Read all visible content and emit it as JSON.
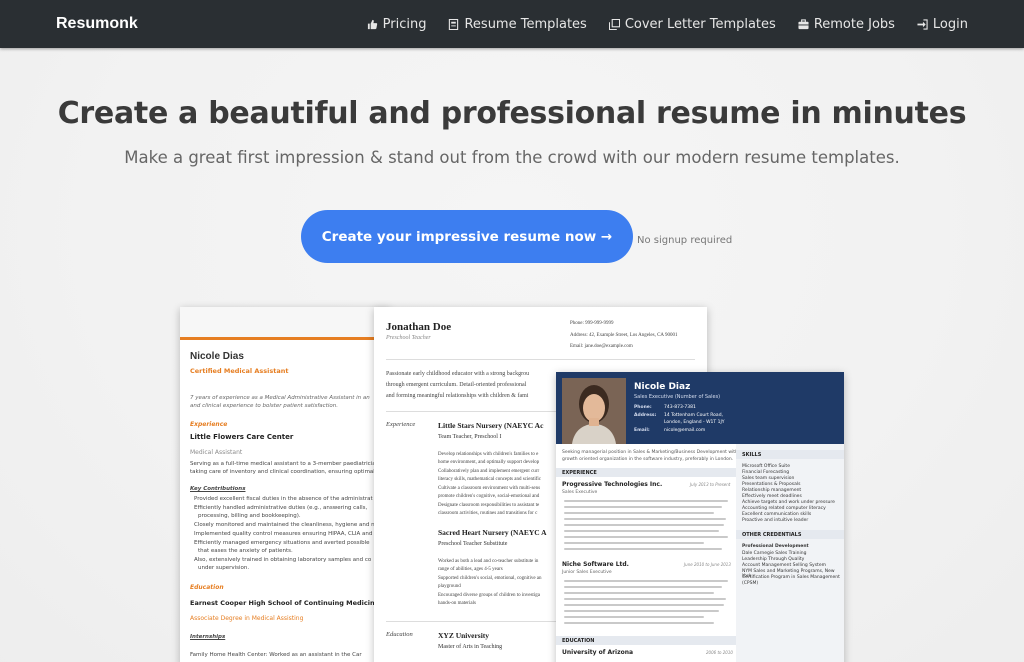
{
  "brand": "Resumonk",
  "nav": {
    "pricing": "Pricing",
    "resume_templates": "Resume Templates",
    "cover_letter_templates": "Cover Letter Templates",
    "remote_jobs": "Remote Jobs",
    "login": "Login"
  },
  "hero": {
    "title": "Create a beautiful and professional resume in minutes",
    "subtitle": "Make a great first impression & stand out from the crowd with our modern resume templates.",
    "cta": "Create your impressive resume now →",
    "cta_note": "No signup required"
  },
  "resume1": {
    "name": "Nicole Dias",
    "role": "Certified Medical Assistant",
    "summary1": "7 years of experience as a Medical Administrative Assistant in an",
    "summary2": "and clinical experience to bolster patient satisfaction.",
    "section_experience": "Experience",
    "company": "Little Flowers Care Center",
    "job_title": "Medical Assistant",
    "desc1": "Serving as a full-time medical assistant to a 3-member paediatrician",
    "desc2": "taking care of inventory and clinical coordination, ensuring optimal",
    "key_contributions": "Key Contributions",
    "b1": "Provided excellent fiscal duties in the absence of the administrat",
    "b2": "Efficiently handled administrative duties (e.g., answering calls,",
    "b2b": "processing, billing and bookkeeping).",
    "b3": "Closely monitored and maintained the cleanliness, hygiene and n",
    "b4": "Implemented quality control measures ensuring HIPAA, CLIA and",
    "b5": "Efficiently managed emergency situations and averted possible",
    "b5b": "that eases the anxiety of patients.",
    "b6": "Also, extensively trained in obtaining laboratory samples and co",
    "b6b": "under supervision.",
    "section_education": "Education",
    "school": "Earnest Cooper High School of Continuing Medicine",
    "degree": "Associate Degree in Medical Assisting",
    "internships": "Internships",
    "intern1": "Family Home Health Center: Worked as an assistant in the Car"
  },
  "resume2": {
    "name": "Jonathan Doe",
    "role": "Preschool Teacher",
    "phone": "Phone: 999-999-9999",
    "address": "Address: 42, Example Street, Los Angeles, CA 90001",
    "email": "Email: jane.doe@example.com",
    "summary1": "Passionate early childhood educator with a strong backgrou",
    "summary2": "through emergent curriculum. Detail-oriented professional",
    "summary3": "and forming meaningful relationships with children & fami",
    "section_experience": "Experience",
    "job1": "Little Stars Nursery (NAEYC Ac",
    "job1_title": "Team Teacher, Preschool I",
    "job1_b1": "Develop relationships with children's families to e",
    "job1_b1b": "home environment, and optimally support develop",
    "job1_b2": "Collaboratively plan and implement emergent curr",
    "job1_b2b": "literacy skills, mathematical concepts and scientific",
    "job1_b3": "Cultivate a classroom environment with multi-sens",
    "job1_b3b": "promote children's cognitive, social-emotional and",
    "job1_b4": "Designate classroom responsibilities to assistant te",
    "job1_b4b": "classroom activities, routines and transitions for c",
    "job2": "Sacred Heart Nursery (NAEYC A",
    "job2_title": "Preschool Teacher Substitute",
    "job2_b1": "Worked as both a lead and co-teacher substitute in",
    "job2_b1b": "range of abilities, ages 4-5 years",
    "job2_b2": "Supported children's social, emotional, cognitive an",
    "job2_b2b": "playground",
    "job2_b3": "Encouraged diverse groups of children to investiga",
    "job2_b3b": "hands-on materials",
    "section_education": "Education",
    "school": "XYZ University",
    "degree": "Master of Arts in Teaching"
  },
  "resume3": {
    "name": "Nicole Diaz",
    "role": "Sales Executive (Number of Sales)",
    "phone_label": "Phone:",
    "phone": "743-873-7381",
    "address_label": "Address:",
    "address1": "14 Tottenham Court Road,",
    "address2": "London, England - W1T 1JY",
    "email_label": "Email:",
    "email": "nicole@email.com",
    "summary1": "Seeking managerial position in Sales & Marketing/Business Development with a",
    "summary2": "growth oriented organization in the software industry, preferably in London.",
    "section_experience": "EXPERIENCE",
    "co1": "Progressive Technologies Inc.",
    "co1_dates": "July 2013 to Present",
    "co1_title": "Sales Executive",
    "co2": "Niche Software Ltd.",
    "co2_dates": "June 2010 to June 2013",
    "co2_title": "Junior Sales Executive",
    "section_education": "EDUCATION",
    "school": "University of Arizona",
    "school_dates": "2006 to 2010",
    "skills_head": "SKILLS",
    "skills": [
      "Microsoft Office Suite",
      "Financial Forecasting",
      "Sales team supervision",
      "Presentations & Proposals",
      "Relationship management",
      "Effectively meet deadlines",
      "Achieve targets and work under pressure",
      "Accounting related computer literacy",
      "Excellent communication skills",
      "Proactive and intuitive leader"
    ],
    "other_head": "OTHER CREDENTIALS",
    "prof_dev": "Professional Development",
    "credentials": [
      "Dale Carnegie Sales Training",
      "Leadership Through Quality",
      "Account Management Selling System",
      "NYM Sales and Marketing Programs, New York",
      "Certification Program in Sales Management",
      "(CPSM)"
    ]
  }
}
